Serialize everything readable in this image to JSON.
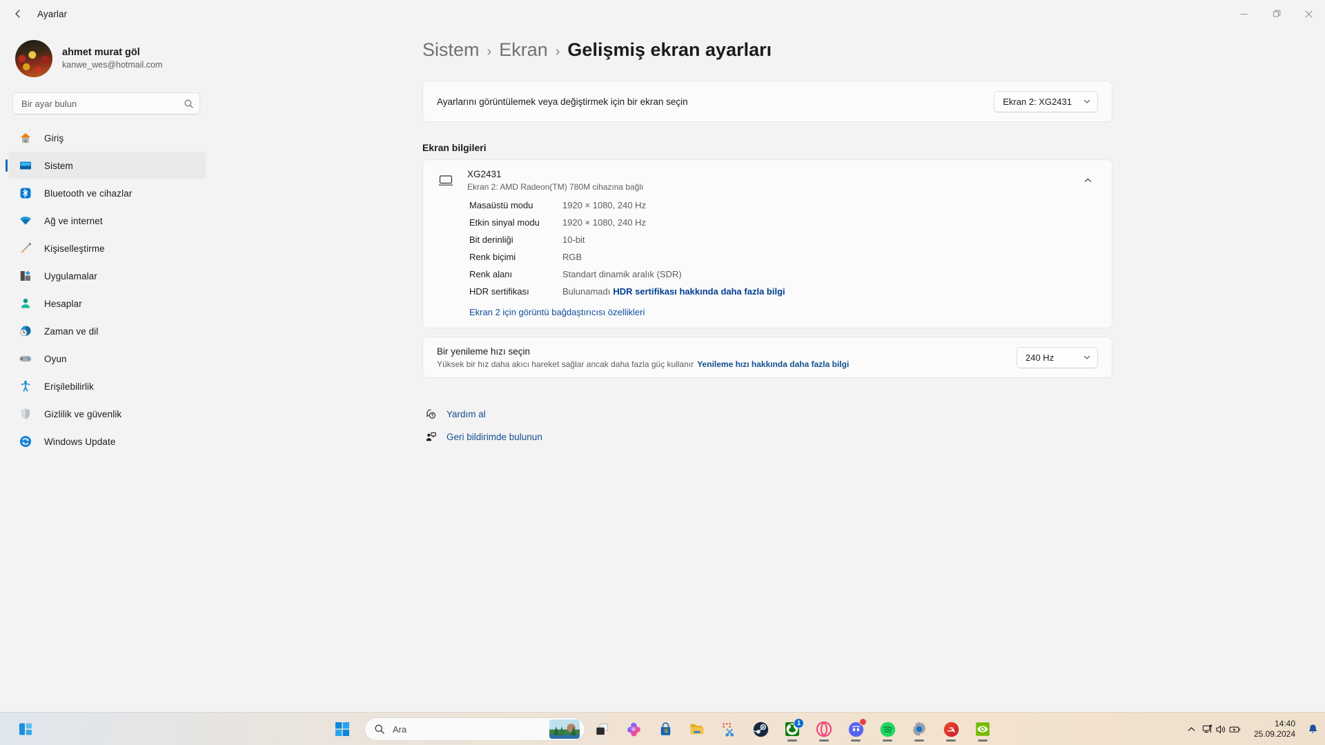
{
  "window": {
    "title": "Ayarlar",
    "back_icon": "back-arrow-icon",
    "minimize_icon": "minimize-icon",
    "maximize_icon": "maximize-icon",
    "close_icon": "close-icon"
  },
  "sidebar": {
    "account": {
      "name": "ahmet murat göl",
      "email": "kanwe_wes@hotmail.com",
      "avatar_icon": "user-avatar"
    },
    "search": {
      "placeholder": "Bir ayar bulun",
      "value": "",
      "icon": "search-icon"
    },
    "items": [
      {
        "label": "Giriş",
        "icon": "home-icon",
        "selected": false
      },
      {
        "label": "Sistem",
        "icon": "system-monitor-icon",
        "selected": true
      },
      {
        "label": "Bluetooth ve cihazlar",
        "icon": "bluetooth-icon",
        "selected": false
      },
      {
        "label": "Ağ ve internet",
        "icon": "wifi-icon",
        "selected": false
      },
      {
        "label": "Kişiselleştirme",
        "icon": "paintbrush-icon",
        "selected": false
      },
      {
        "label": "Uygulamalar",
        "icon": "apps-icon",
        "selected": false
      },
      {
        "label": "Hesaplar",
        "icon": "person-icon",
        "selected": false
      },
      {
        "label": "Zaman ve dil",
        "icon": "clock-globe-icon",
        "selected": false
      },
      {
        "label": "Oyun",
        "icon": "gamepad-icon",
        "selected": false
      },
      {
        "label": "Erişilebilirlik",
        "icon": "accessibility-icon",
        "selected": false
      },
      {
        "label": "Gizlilik ve güvenlik",
        "icon": "shield-icon",
        "selected": false
      },
      {
        "label": "Windows Update",
        "icon": "refresh-circle-icon",
        "selected": false
      }
    ]
  },
  "breadcrumb": {
    "root": "Sistem",
    "parent": "Ekran",
    "current": "Gelişmiş ekran ayarları",
    "separator": "›"
  },
  "display_select": {
    "label": "Ayarlarını görüntülemek veya değiştirmek için bir ekran seçin",
    "value": "Ekran 2: XG2431",
    "chevron_icon": "chevron-down-icon"
  },
  "display_info": {
    "section_title": "Ekran bilgileri",
    "monitor_icon": "monitor-icon",
    "monitor_name": "XG2431",
    "monitor_sub": "Ekran 2: AMD Radeon(TM) 780M cihazına bağlı",
    "collapse_icon": "chevron-up-icon",
    "rows": [
      {
        "key": "Masaüstü modu",
        "value": "1920 × 1080, 240 Hz",
        "link": ""
      },
      {
        "key": "Etkin sinyal modu",
        "value": "1920 × 1080, 240 Hz",
        "link": ""
      },
      {
        "key": "Bit derinliği",
        "value": "10-bit",
        "link": ""
      },
      {
        "key": "Renk biçimi",
        "value": "RGB",
        "link": ""
      },
      {
        "key": "Renk alanı",
        "value": "Standart dinamik aralık (SDR)",
        "link": ""
      },
      {
        "key": "HDR sertifikası",
        "value": "Bulunamadı",
        "link": "HDR sertifikası hakkında daha fazla bilgi"
      }
    ],
    "adapter_link": "Ekran 2 için görüntü bağdaştırıcısı özellikleri"
  },
  "refresh_rate": {
    "title": "Bir yenileme hızı seçin",
    "subtitle": "Yüksek bir hız daha akıcı hareket sağlar ancak daha fazla güç kullanır",
    "link": "Yenileme hızı hakkında daha fazla bilgi",
    "value": "240 Hz",
    "chevron_icon": "chevron-down-icon"
  },
  "footer_links": [
    {
      "label": "Yardım al",
      "icon": "help-question-icon"
    },
    {
      "label": "Geri bildirimde bulunun",
      "icon": "feedback-person-icon"
    }
  ],
  "taskbar": {
    "widgets_icon": "widgets-icon",
    "start_icon": "windows-start-icon",
    "search": {
      "placeholder": "Ara",
      "icon": "search-icon",
      "thumb_icon": "landscape-thumbnail-icon"
    },
    "apps": [
      {
        "icon": "task-view-icon",
        "name": "task-view",
        "running": false,
        "badge": "",
        "dot": false
      },
      {
        "icon": "copilot-icon",
        "name": "copilot",
        "running": false,
        "badge": "",
        "dot": false
      },
      {
        "icon": "microsoft-store-icon",
        "name": "microsoft-store",
        "running": false,
        "badge": "",
        "dot": false
      },
      {
        "icon": "file-explorer-icon",
        "name": "file-explorer",
        "running": false,
        "badge": "",
        "dot": false
      },
      {
        "icon": "snipping-tool-icon",
        "name": "snipping-tool",
        "running": false,
        "badge": "",
        "dot": false
      },
      {
        "icon": "steam-icon",
        "name": "steam",
        "running": true,
        "badge": "",
        "dot": false
      },
      {
        "icon": "xbox-icon",
        "name": "xbox",
        "running": true,
        "badge": "1",
        "dot": false
      },
      {
        "icon": "opera-gx-icon",
        "name": "opera-gx",
        "running": true,
        "badge": "",
        "dot": false
      },
      {
        "icon": "discord-icon",
        "name": "discord",
        "running": true,
        "badge": "",
        "dot": true
      },
      {
        "icon": "spotify-icon",
        "name": "spotify",
        "running": true,
        "badge": "",
        "dot": false
      },
      {
        "icon": "settings-gear-icon",
        "name": "settings",
        "running": true,
        "badge": "",
        "dot": false
      },
      {
        "icon": "ea-app-icon",
        "name": "ea-app",
        "running": true,
        "badge": "",
        "dot": false
      },
      {
        "icon": "nvidia-icon",
        "name": "nvidia-app",
        "running": true,
        "badge": "",
        "dot": false
      }
    ],
    "tray": {
      "overflow_icon": "chevron-up-icon",
      "network_icon": "ethernet-icon",
      "volume_icon": "speaker-icon",
      "battery_icon": "battery-charging-icon",
      "time": "14:40",
      "date": "25.09.2024",
      "notification_icon": "bell-icon"
    }
  },
  "colors": {
    "accent": "#0f6cbd",
    "link": "#14508f",
    "link_strong": "#003e92",
    "sidebar_bg": "#f3f3f3",
    "card_bg": "#fbfbfb",
    "text": "#1b1b1b",
    "text_secondary": "#5f5f5f"
  }
}
